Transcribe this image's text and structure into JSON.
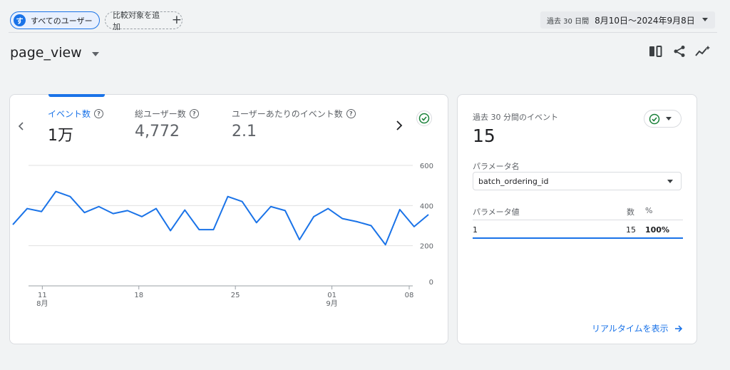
{
  "header": {
    "segment_avatar": "す",
    "segment_label": "すべてのユーザー",
    "compare_label": "比較対象を追加",
    "date_period": "過去 30 日間",
    "date_range": "8月10日～2024年9月8日"
  },
  "page": {
    "title": "page_view",
    "actions": [
      "compare-columns-icon",
      "share-icon",
      "insights-icon"
    ]
  },
  "metrics": [
    {
      "label": "イベント数",
      "value": "1万"
    },
    {
      "label": "総ユーザー数",
      "value": "4,772"
    },
    {
      "label": "ユーザーあたりのイベント数",
      "value": "2.1"
    }
  ],
  "chart_data": {
    "type": "line",
    "title": "",
    "xlabel": "",
    "ylabel": "",
    "series": [
      {
        "color": "#1a73e8",
        "values": [
          305,
          385,
          370,
          470,
          445,
          365,
          395,
          360,
          375,
          345,
          385,
          275,
          378,
          280,
          280,
          445,
          420,
          315,
          395,
          375,
          230,
          345,
          385,
          335,
          320,
          300,
          205,
          380,
          295,
          355
        ]
      }
    ],
    "x": [
      "8-10",
      "8-11",
      "8-12",
      "8-13",
      "8-14",
      "8-15",
      "8-16",
      "8-17",
      "8-18",
      "8-19",
      "8-20",
      "8-21",
      "8-22",
      "8-23",
      "8-24",
      "8-25",
      "8-26",
      "8-27",
      "8-28",
      "8-29",
      "8-30",
      "8-31",
      "9-01",
      "9-02",
      "9-03",
      "9-04",
      "9-05",
      "9-06",
      "9-07",
      "9-08"
    ],
    "x_ticks": [
      {
        "day": "11",
        "month": "8月"
      },
      {
        "day": "18",
        "month": ""
      },
      {
        "day": "25",
        "month": ""
      },
      {
        "day": "01",
        "month": "9月"
      },
      {
        "day": "08",
        "month": ""
      }
    ],
    "y_ticks": [
      "600",
      "400",
      "200",
      "0"
    ],
    "ylim": [
      0,
      600
    ],
    "grid": true
  },
  "realtime": {
    "title": "過去 30 分間のイベント",
    "value": "15",
    "param_label": "パラメータ名",
    "param_selected": "batch_ordering_id",
    "table": {
      "headers": [
        "パラメータ値",
        "数",
        "%"
      ],
      "rows": [
        [
          "1",
          "15",
          "100%"
        ]
      ]
    },
    "link_label": "リアルタイムを表示"
  },
  "colors": {
    "accent": "#1a73e8",
    "success": "#188038",
    "background": "#f1f3f4"
  }
}
